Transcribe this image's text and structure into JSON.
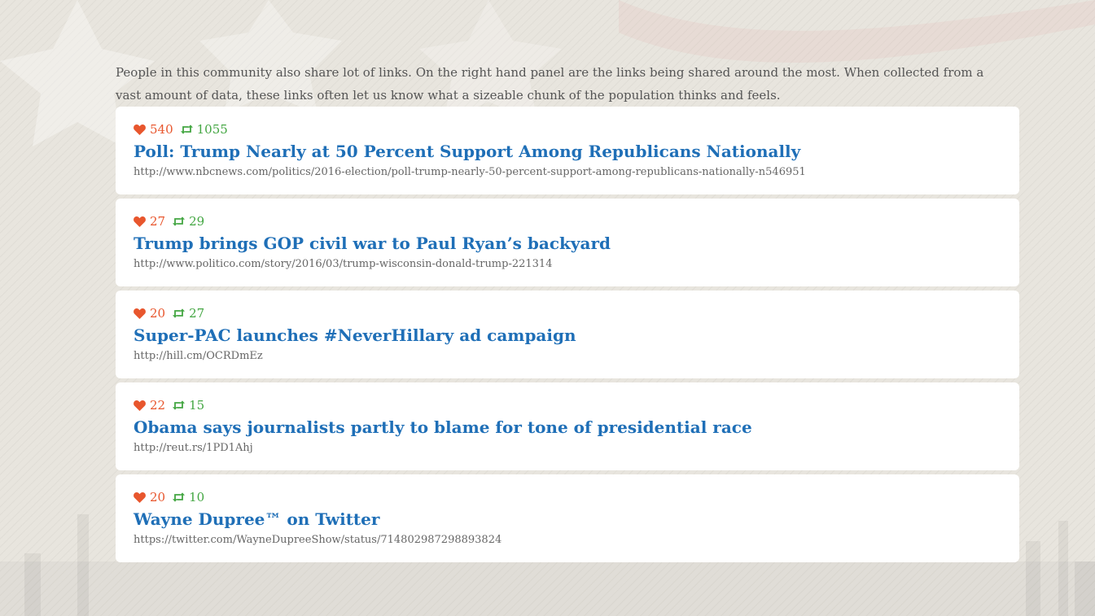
{
  "intro_text": "People in this community also share lot of links. On the right hand panel are the links being shared around the most. When collected from a vast amount of data, these links often let us know what a sizeable chunk of the population thinks and feels.",
  "colors": {
    "likes": "#e8562d",
    "retweets": "#43a642",
    "link_title": "#1f6fb7"
  },
  "icons": {
    "likes": "heart-icon",
    "retweets": "retweet-icon"
  },
  "links": [
    {
      "likes": "540",
      "retweets": "1055",
      "title": "Poll: Trump Nearly at 50 Percent Support Among Republicans Nationally",
      "url": "http://www.nbcnews.com/politics/2016-election/poll-trump-nearly-50-percent-support-among-republicans-nationally-n546951"
    },
    {
      "likes": "27",
      "retweets": "29",
      "title": "Trump brings GOP civil war to Paul Ryan’s backyard",
      "url": "http://www.politico.com/story/2016/03/trump-wisconsin-donald-trump-221314"
    },
    {
      "likes": "20",
      "retweets": "27",
      "title": "Super-PAC launches #NeverHillary ad campaign",
      "url": "http://hill.cm/OCRDmEz"
    },
    {
      "likes": "22",
      "retweets": "15",
      "title": "Obama says journalists partly to blame for tone of presidential race",
      "url": "http://reut.rs/1PD1Ahj"
    },
    {
      "likes": "20",
      "retweets": "10",
      "title": "Wayne Dupree™ on Twitter",
      "url": "https://twitter.com/WayneDupreeShow/status/714802987298893824"
    }
  ]
}
